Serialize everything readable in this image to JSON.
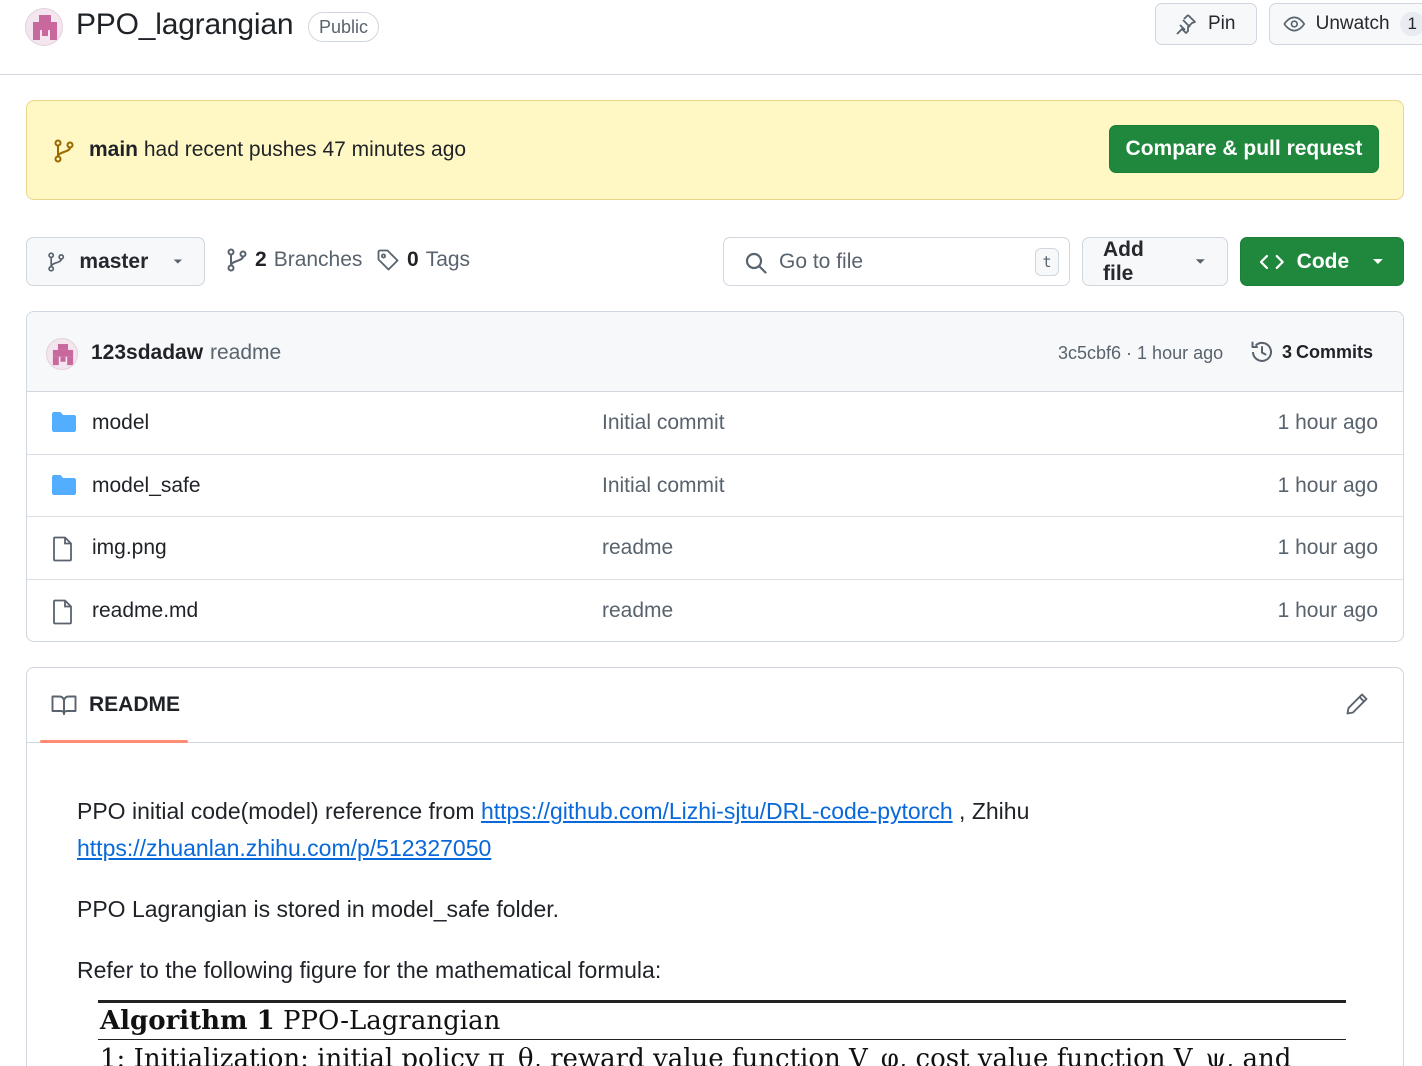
{
  "header": {
    "repo_name": "PPO_lagrangian",
    "visibility": "Public",
    "pin_label": "Pin",
    "unwatch_label": "Unwatch",
    "watch_count": "1"
  },
  "banner": {
    "branch": "main",
    "text": "had recent pushes 47 minutes ago",
    "compare_label": "Compare & pull request"
  },
  "toolbar": {
    "branch": "master",
    "branches_count": "2",
    "branches_label": "Branches",
    "tags_count": "0",
    "tags_label": "Tags",
    "search_placeholder": "Go to file",
    "search_shortcut": "t",
    "add_file_label": "Add file",
    "code_label": "Code"
  },
  "latest_commit": {
    "author": "123sdadaw",
    "message": "readme",
    "hash_time": "3c5cbf6 · 1 hour ago",
    "commits_count": "3",
    "commits_label": "Commits"
  },
  "files": [
    {
      "name": "model",
      "type": "folder",
      "message": "Initial commit",
      "time": "1 hour ago"
    },
    {
      "name": "model_safe",
      "type": "folder",
      "message": "Initial commit",
      "time": "1 hour ago"
    },
    {
      "name": "img.png",
      "type": "file",
      "message": "readme",
      "time": "1 hour ago"
    },
    {
      "name": "readme.md",
      "type": "file",
      "message": "readme",
      "time": "1 hour ago"
    }
  ],
  "readme": {
    "tab_label": "README",
    "p1_prefix": "PPO initial code(model) reference from",
    "p1_link1": "https://github.com/Lizhi-sjtu/DRL-code-pytorch",
    "p1_mid": ", Zhihu",
    "p1_link2": "https://zhuanlan.zhihu.com/p/512327050",
    "p2": "PPO Lagrangian is stored in model_safe folder.",
    "p3": "Refer to the following figure for the mathematical formula:",
    "algo_title_bold": "Algorithm 1",
    "algo_title_rest": "PPO-Lagrangian",
    "algo_line1": "1:  Initialization:  initial policy π_θ,  reward value function V_φ,  cost value function V_ψ,  and"
  },
  "colors": {
    "green": "#1f883d",
    "link": "#0969da",
    "banner_bg": "#fff8c5",
    "folder": "#54aeff",
    "tab_underline": "#fd8c73"
  }
}
